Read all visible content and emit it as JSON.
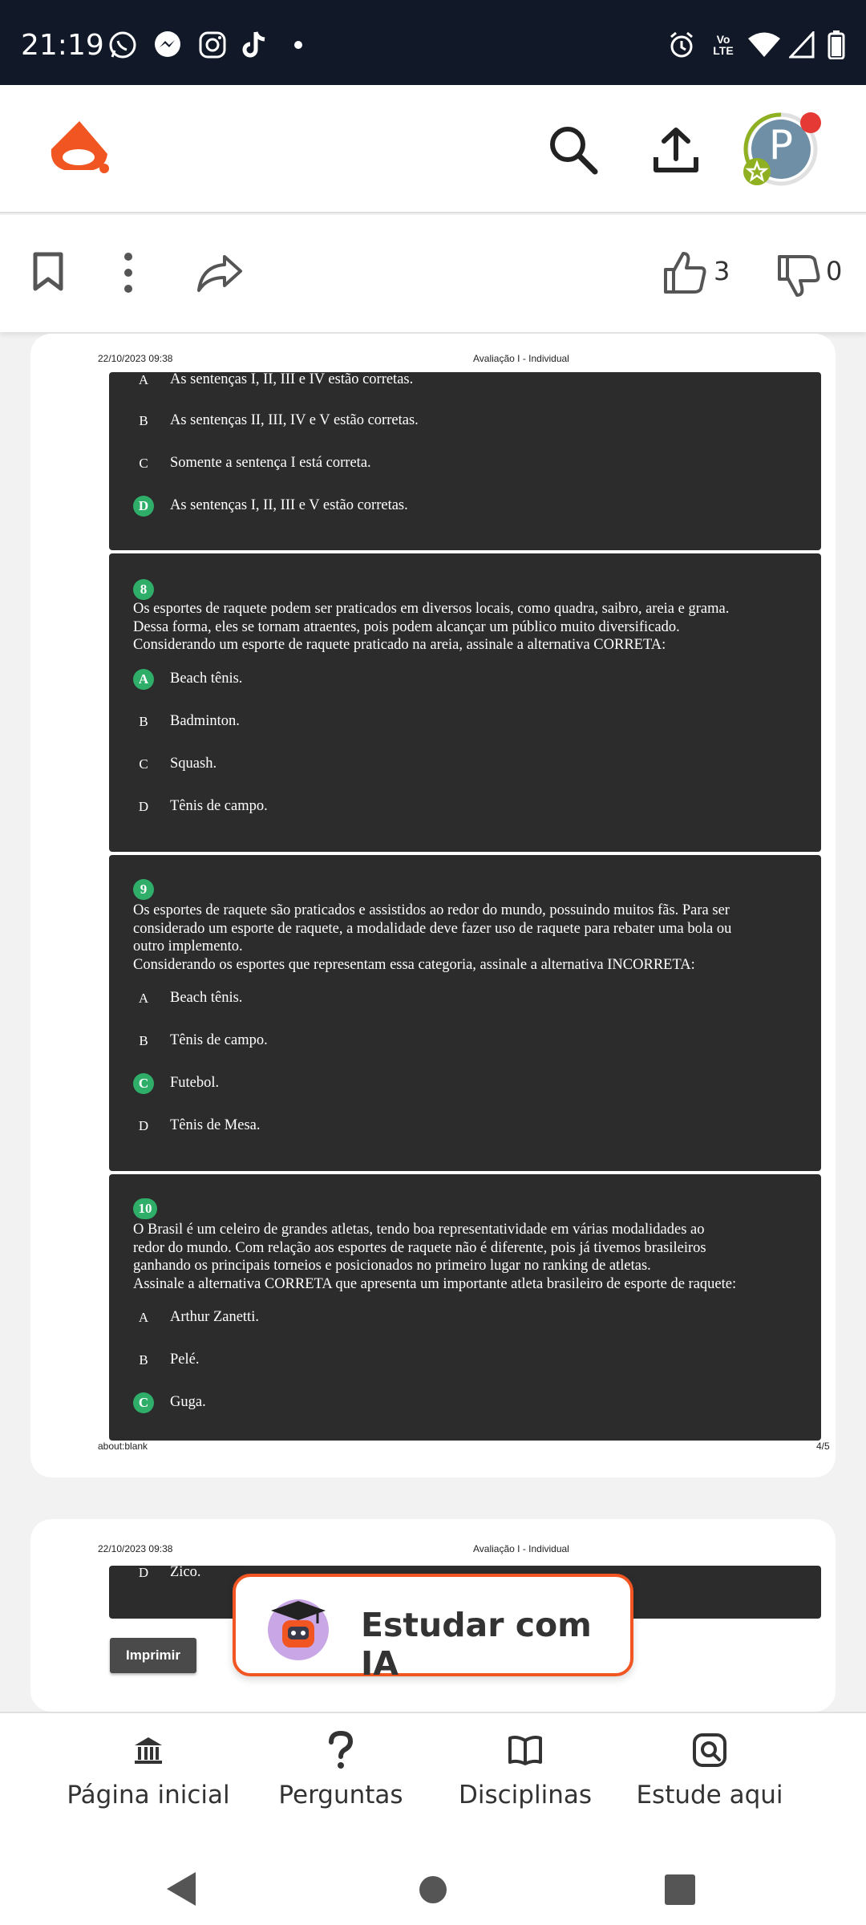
{
  "status_bar": {
    "time": "21:19",
    "network_label": "Vo LTE"
  },
  "app_bar": {
    "avatar_letter": "P"
  },
  "actions": {
    "likes": "3",
    "dislikes": "0"
  },
  "page4": {
    "header_date": "22/10/2023 09:38",
    "header_title": "Avaliação I - Individual",
    "footer_url": "about:blank",
    "footer_page": "4/5",
    "q7_options": [
      {
        "letter": "A",
        "text": "As sentenças I, II, III e IV estão corretas."
      },
      {
        "letter": "B",
        "text": "As sentenças II, III, IV e V estão corretas."
      },
      {
        "letter": "C",
        "text": "Somente a sentença I está correta."
      },
      {
        "letter": "D",
        "text": "As sentenças I, II, III e V estão corretas."
      }
    ],
    "q8": {
      "number": "8",
      "lines": [
        "Os esportes de raquete podem ser praticados em diversos locais, como quadra, saibro, areia e grama.",
        "Dessa forma, eles se tornam atraentes, pois podem alcançar um público muito diversificado.",
        "Considerando um esporte de raquete praticado na areia, assinale a alternativa CORRETA:"
      ],
      "options": [
        {
          "letter": "A",
          "text": "Beach tênis."
        },
        {
          "letter": "B",
          "text": "Badminton."
        },
        {
          "letter": "C",
          "text": "Squash."
        },
        {
          "letter": "D",
          "text": "Tênis de campo."
        }
      ]
    },
    "q9": {
      "number": "9",
      "lines": [
        "Os esportes de raquete são praticados e assistidos ao redor do mundo, possuindo muitos fãs. Para ser",
        "considerado um esporte de raquete, a modalidade deve fazer uso de raquete para rebater uma bola ou",
        "outro implemento.",
        "Considerando os esportes que representam essa categoria, assinale a alternativa INCORRETA:"
      ],
      "options": [
        {
          "letter": "A",
          "text": "Beach tênis."
        },
        {
          "letter": "B",
          "text": "Tênis de campo."
        },
        {
          "letter": "C",
          "text": "Futebol."
        },
        {
          "letter": "D",
          "text": "Tênis de Mesa."
        }
      ]
    },
    "q10": {
      "number": "10",
      "lines": [
        "O Brasil é um celeiro de grandes atletas, tendo boa representatividade em várias modalidades ao",
        "redor do mundo. Com relação aos esportes de raquete não é diferente, pois já tivemos brasileiros",
        "ganhando os principais torneios e posicionados no primeiro lugar no ranking de atletas.",
        "Assinale a alternativa CORRETA que apresenta um importante atleta brasileiro de esporte de raquete:"
      ],
      "options": [
        {
          "letter": "A",
          "text": "Arthur Zanetti."
        },
        {
          "letter": "B",
          "text": "Pelé."
        },
        {
          "letter": "C",
          "text": "Guga."
        }
      ]
    }
  },
  "page5": {
    "header_date": "22/10/2023 09:38",
    "header_title": "Avaliação I - Individual",
    "option": {
      "letter": "D",
      "text": "Zico."
    },
    "print_label": "Imprimir"
  },
  "ia_button": {
    "label": "Estudar com IA"
  },
  "bottom_nav": [
    {
      "label": "Página inicial",
      "icon": "bank-icon"
    },
    {
      "label": "Perguntas",
      "icon": "question-icon"
    },
    {
      "label": "Disciplinas",
      "icon": "book-icon"
    },
    {
      "label": "Estude aqui",
      "icon": "study-search-icon"
    }
  ],
  "colors": {
    "brand": "#f05522",
    "correct": "#2fae6a",
    "dark_bg": "#2c2c2c"
  }
}
